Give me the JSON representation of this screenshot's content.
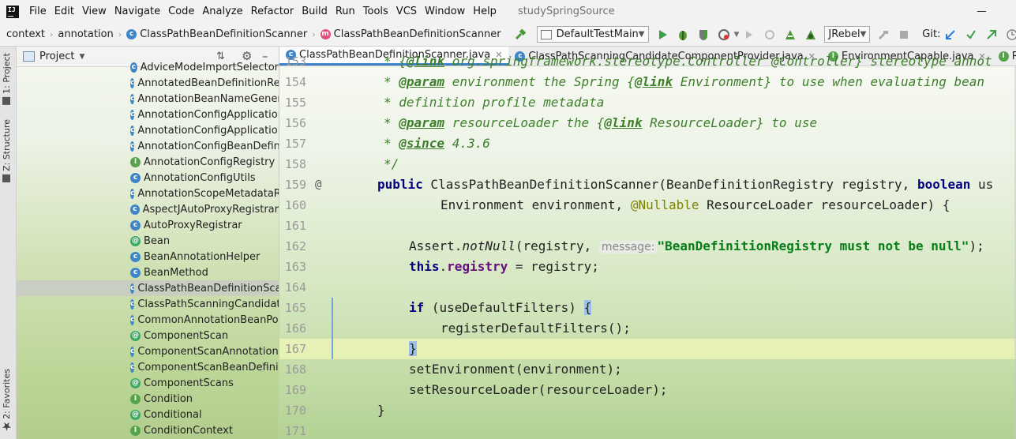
{
  "menubar": {
    "items": [
      "File",
      "Edit",
      "View",
      "Navigate",
      "Code",
      "Analyze",
      "Refactor",
      "Build",
      "Run",
      "Tools",
      "VCS",
      "Window",
      "Help"
    ],
    "project_name": "studySpringSource"
  },
  "toolbar": {
    "breadcrumbs": [
      {
        "label": "context",
        "icon": "folder-icon"
      },
      {
        "label": "annotation",
        "icon": "folder-icon"
      },
      {
        "label": "ClassPathBeanDefinitionScanner",
        "icon": "class-icon"
      },
      {
        "label": "ClassPathBeanDefinitionScanner",
        "icon": "method-icon"
      }
    ],
    "run_config": "DefaultTestMain",
    "jrebel": "JRebel",
    "git_label": "Git:"
  },
  "sidebar": {
    "project_tab": "1: Project",
    "structure_tab": "Z: Structure",
    "favorites_tab": "2: Favorites"
  },
  "project": {
    "title": "Project",
    "items": [
      {
        "label": "AdviceModeImportSelector",
        "kind": "class"
      },
      {
        "label": "AnnotatedBeanDefinitionRead",
        "kind": "class"
      },
      {
        "label": "AnnotationBeanNameGenerat",
        "kind": "class"
      },
      {
        "label": "AnnotationConfigApplicationC",
        "kind": "class"
      },
      {
        "label": "AnnotationConfigApplicationC",
        "kind": "class"
      },
      {
        "label": "AnnotationConfigBeanDefiniti",
        "kind": "class"
      },
      {
        "label": "AnnotationConfigRegistry",
        "kind": "interface"
      },
      {
        "label": "AnnotationConfigUtils",
        "kind": "class"
      },
      {
        "label": "AnnotationScopeMetadataRes",
        "kind": "class"
      },
      {
        "label": "AspectJAutoProxyRegistrar",
        "kind": "class"
      },
      {
        "label": "AutoProxyRegistrar",
        "kind": "class"
      },
      {
        "label": "Bean",
        "kind": "annotation"
      },
      {
        "label": "BeanAnnotationHelper",
        "kind": "class"
      },
      {
        "label": "BeanMethod",
        "kind": "class"
      },
      {
        "label": "ClassPathBeanDefinitionScann",
        "kind": "class",
        "selected": true
      },
      {
        "label": "ClassPathScanningCandidateC",
        "kind": "class"
      },
      {
        "label": "CommonAnnotationBeanPostF",
        "kind": "class"
      },
      {
        "label": "ComponentScan",
        "kind": "annotation"
      },
      {
        "label": "ComponentScanAnnotationPa",
        "kind": "class"
      },
      {
        "label": "ComponentScanBeanDefinitio",
        "kind": "class"
      },
      {
        "label": "ComponentScans",
        "kind": "annotation"
      },
      {
        "label": "Condition",
        "kind": "interface"
      },
      {
        "label": "Conditional",
        "kind": "annotation"
      },
      {
        "label": "ConditionContext",
        "kind": "interface"
      }
    ]
  },
  "editor": {
    "tabs": [
      {
        "label": "ClassPathBeanDefinitionScanner.java",
        "kind": "class",
        "active": true
      },
      {
        "label": "ClassPathScanningCandidateComponentProvider.java",
        "kind": "class"
      },
      {
        "label": "EnvironmentCapable.java",
        "kind": "interface"
      },
      {
        "label": "ResourceLoader.ja",
        "kind": "interface"
      }
    ],
    "lines": [
      {
        "n": "153",
        "p": [
          {
            "t": "* ",
            "c": "doc"
          },
          {
            "t": "{",
            "c": "doc"
          },
          {
            "t": "@link",
            "c": "doctag"
          },
          {
            "t": " org.springframework.stereotype.Controller @Controller} stereotype annot",
            "c": "doc"
          }
        ]
      },
      {
        "n": "154",
        "p": [
          {
            "t": "* ",
            "c": "doc"
          },
          {
            "t": "@param",
            "c": "doctag"
          },
          {
            "t": " environment",
            "c": "doc"
          },
          {
            "t": " the Spring {",
            "c": "doc"
          },
          {
            "t": "@link",
            "c": "doctag"
          },
          {
            "t": " Environment} to use when evaluating bean",
            "c": "doc"
          }
        ]
      },
      {
        "n": "155",
        "p": [
          {
            "t": "* definition profile metadata",
            "c": "doc"
          }
        ]
      },
      {
        "n": "156",
        "p": [
          {
            "t": "* ",
            "c": "doc"
          },
          {
            "t": "@param",
            "c": "doctag"
          },
          {
            "t": " resourceLoader the {",
            "c": "doc"
          },
          {
            "t": "@link",
            "c": "doctag"
          },
          {
            "t": " ResourceLoader} to use",
            "c": "doc"
          }
        ]
      },
      {
        "n": "157",
        "p": [
          {
            "t": "* ",
            "c": "doc"
          },
          {
            "t": "@since",
            "c": "doctag"
          },
          {
            "t": " 4.3.6",
            "c": "doc"
          }
        ]
      },
      {
        "n": "158",
        "p": [
          {
            "t": "*/",
            "c": "doc"
          }
        ]
      },
      {
        "n": "159",
        "gutter_mark": "@",
        "p": [
          {
            "t": "public",
            "c": "kw"
          },
          {
            "t": " ClassPathBeanDefinitionScanner(BeanDefinitionRegistry registry, ",
            "c": ""
          },
          {
            "t": "boolean",
            "c": "kw"
          },
          {
            "t": " us",
            "c": ""
          }
        ]
      },
      {
        "n": "160",
        "p": [
          {
            "t": "Environment environment, ",
            "c": ""
          },
          {
            "t": "@Nullable",
            "c": "anno"
          },
          {
            "t": " ResourceLoader resourceLoader) {",
            "c": ""
          }
        ]
      },
      {
        "n": "161",
        "p": []
      },
      {
        "n": "162",
        "p": [
          {
            "t": "Assert.",
            "c": ""
          },
          {
            "t": "notNull",
            "c": "ital"
          },
          {
            "t": "(registry, ",
            "c": ""
          },
          {
            "t": "message:",
            "c": "hint"
          },
          {
            "t": "\"BeanDefinitionRegistry must not be null\"",
            "c": "str"
          },
          {
            "t": ");",
            "c": ""
          }
        ]
      },
      {
        "n": "163",
        "p": [
          {
            "t": "this",
            "c": "kw"
          },
          {
            "t": ".",
            "c": ""
          },
          {
            "t": "registry",
            "c": "field"
          },
          {
            "t": " = registry;",
            "c": ""
          }
        ]
      },
      {
        "n": "164",
        "p": []
      },
      {
        "n": "165",
        "p": [
          {
            "t": "if",
            "c": "kw"
          },
          {
            "t": " (useDefaultFilters) ",
            "c": ""
          },
          {
            "t": "{",
            "c": "brace-hl"
          }
        ]
      },
      {
        "n": "166",
        "p": [
          {
            "t": "registerDefaultFilters();",
            "c": ""
          }
        ]
      },
      {
        "n": "167",
        "hl": true,
        "p": [
          {
            "t": "}",
            "c": "brace-hl"
          }
        ]
      },
      {
        "n": "168",
        "p": [
          {
            "t": "setEnvironment(environment);",
            "c": ""
          }
        ]
      },
      {
        "n": "169",
        "p": [
          {
            "t": "setResourceLoader(resourceLoader);",
            "c": ""
          }
        ]
      },
      {
        "n": "170",
        "p": [
          {
            "t": "}",
            "c": ""
          }
        ]
      },
      {
        "n": "171",
        "p": []
      }
    ]
  }
}
